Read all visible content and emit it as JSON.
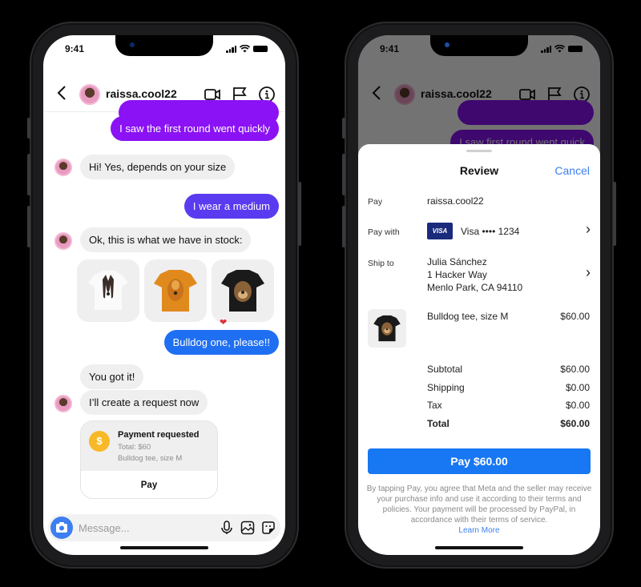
{
  "status_bar": {
    "time": "9:41"
  },
  "colors": {
    "purple": "#8a12f5",
    "indigo": "#5b3bf0",
    "blue": "#1f6ff2",
    "gray_bubble": "#efefef",
    "pay_blue": "#1877f2",
    "link_blue": "#3d7ff0",
    "coin": "#f7b928"
  },
  "chat": {
    "header": {
      "username": "raissa.cool22"
    },
    "messages": [
      {
        "from": "me",
        "text": "I saw the first round went quickly"
      },
      {
        "from": "them",
        "text": "Hi! Yes, depends on your size"
      },
      {
        "from": "me",
        "text": "I wear a medium"
      },
      {
        "from": "them",
        "text": "Ok, this is what we have in stock:"
      },
      {
        "from": "me",
        "text": "Bulldog one, please!!"
      },
      {
        "from": "them",
        "text": "You got it!"
      },
      {
        "from": "them",
        "text": "I’ll create a request now"
      }
    ],
    "products": [
      {
        "name": "White tee with border collie",
        "liked": false
      },
      {
        "name": "Orange tee with golden retriever",
        "liked": false
      },
      {
        "name": "Black tee with bulldog",
        "liked": true
      }
    ],
    "payment_request": {
      "title": "Payment requested",
      "total": "Total: $60",
      "item": "Bulldog tee, size M",
      "pay_label": "Pay",
      "coin_symbol": "$"
    },
    "composer": {
      "placeholder": "Message..."
    }
  },
  "review": {
    "header_bg_message": "I saw first round went quick",
    "title": "Review",
    "cancel_label": "Cancel",
    "pay": {
      "label": "Pay",
      "value": "raissa.cool22"
    },
    "pay_with": {
      "label": "Pay with",
      "card_brand": "VISA",
      "value": "Visa •••• 1234"
    },
    "ship_to": {
      "label": "Ship to",
      "name": "Julia Sánchez",
      "line1": "1 Hacker Way",
      "line2": "Menlo Park, CA 94110"
    },
    "item": {
      "name": "Bulldog tee, size M",
      "price": "$60.00"
    },
    "summary": [
      {
        "label": "Subtotal",
        "value": "$60.00",
        "bold": false
      },
      {
        "label": "Shipping",
        "value": "$0.00",
        "bold": false
      },
      {
        "label": "Tax",
        "value": "$0.00",
        "bold": false
      },
      {
        "label": "Total",
        "value": "$60.00",
        "bold": true
      }
    ],
    "pay_button": "Pay $60.00",
    "legal": "By tapping Pay, you agree that Meta and the seller may receive your purchase info and use it according to their terms and policies. Your payment will be processed by PayPal, in accordance with their terms of service.",
    "learn_more": "Learn More"
  }
}
